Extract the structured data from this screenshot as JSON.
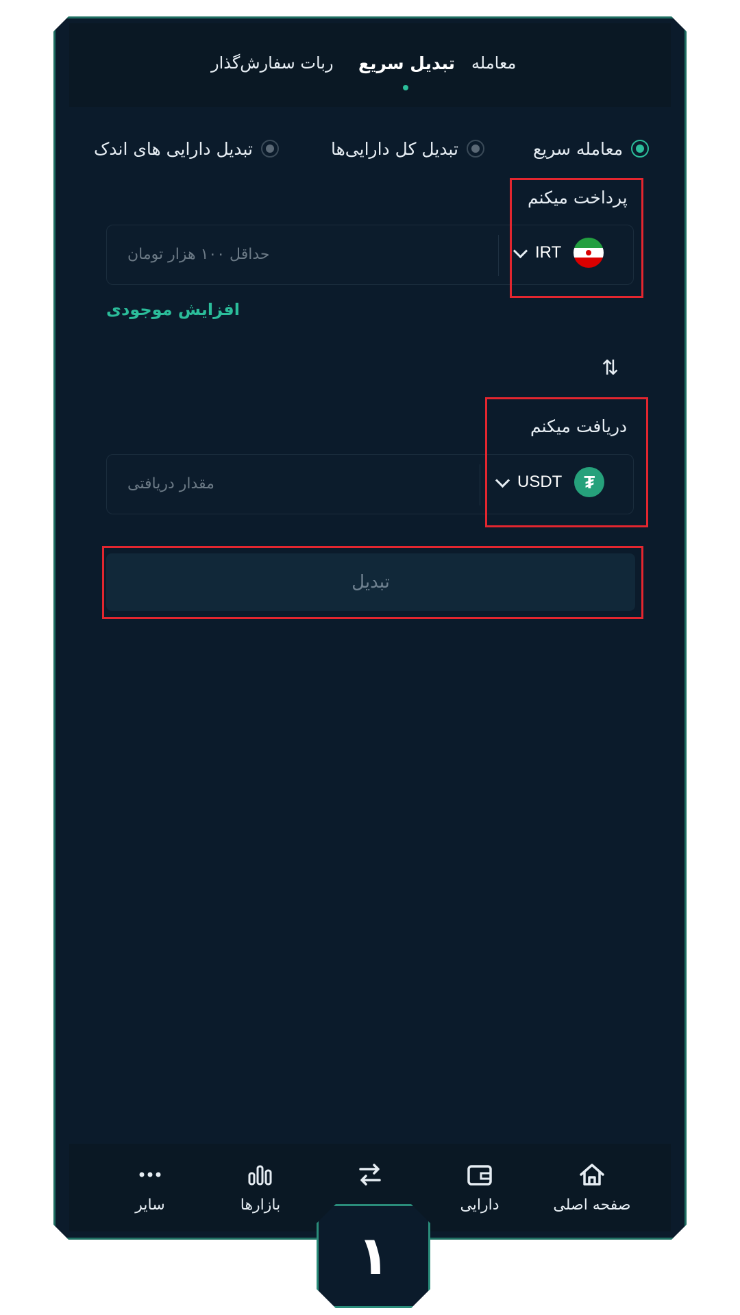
{
  "tabs": {
    "trade": "معامله",
    "quick_convert": "تبدیل سریع",
    "order_bot": "ربات سفارش‌گذار"
  },
  "options": {
    "quick_trade": "معامله سریع",
    "convert_all": "تبدیل کل دارایی‌ها",
    "convert_small": "تبدیل دارایی های اندک"
  },
  "pay": {
    "label": "پرداخت میکنم",
    "currency": "IRT",
    "placeholder": "حداقل ۱۰۰ هزار تومان"
  },
  "increase_balance": "افزایش موجودی",
  "receive": {
    "label": "دریافت میکنم",
    "currency": "USDT",
    "placeholder": "مقدار دریافتی"
  },
  "convert_button": "تبدیل",
  "nav": {
    "home": "صفحه اصلی",
    "assets": "دارایی",
    "markets": "بازارها",
    "other": "سایر"
  },
  "step_badge": "۱",
  "colors": {
    "accent": "#2bbd9a",
    "background": "#0b1b2b",
    "highlight": "#e3262f"
  }
}
